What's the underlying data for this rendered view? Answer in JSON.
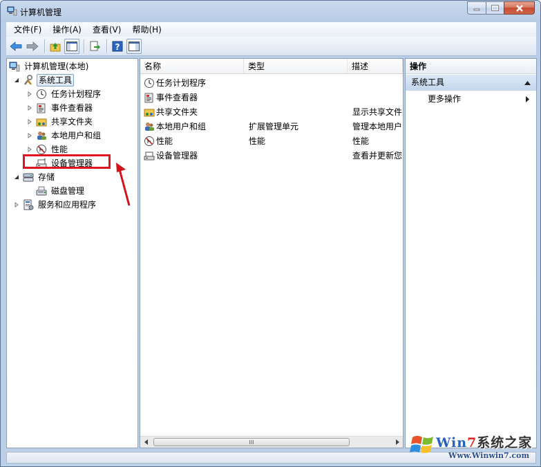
{
  "window": {
    "title": "计算机管理"
  },
  "menu": [
    "文件(F)",
    "操作(A)",
    "查看(V)",
    "帮助(H)"
  ],
  "tree": {
    "root": "计算机管理(本地)",
    "system_tools": "系统工具",
    "task_scheduler": "任务计划程序",
    "event_viewer": "事件查看器",
    "shared_folders": "共享文件夹",
    "local_users": "本地用户和组",
    "performance": "性能",
    "device_manager": "设备管理器",
    "storage": "存储",
    "disk_management": "磁盘管理",
    "services_apps": "服务和应用程序"
  },
  "list": {
    "headers": {
      "name": "名称",
      "type": "类型",
      "desc": "描述"
    },
    "rows": [
      {
        "name": "任务计划程序",
        "type": "",
        "desc": ""
      },
      {
        "name": "事件查看器",
        "type": "",
        "desc": ""
      },
      {
        "name": "共享文件夹",
        "type": "",
        "desc": "显示共享文件"
      },
      {
        "name": "本地用户和组",
        "type": "扩展管理单元",
        "desc": "管理本地用户"
      },
      {
        "name": "性能",
        "type": "性能",
        "desc": "性能"
      },
      {
        "name": "设备管理器",
        "type": "",
        "desc": "查看并更新您"
      }
    ],
    "scroll_grip": "III"
  },
  "actions": {
    "header": "操作",
    "section": "系统工具",
    "more": "更多操作"
  },
  "watermark": {
    "brand_a": "Win",
    "brand_b": "7",
    "brand_c": "系统之家",
    "url": "Www.Winwin7.com"
  },
  "colors": {
    "highlight_box": "#e0141e",
    "arrow": "#d4121c",
    "frame": "#bcd0e8"
  }
}
